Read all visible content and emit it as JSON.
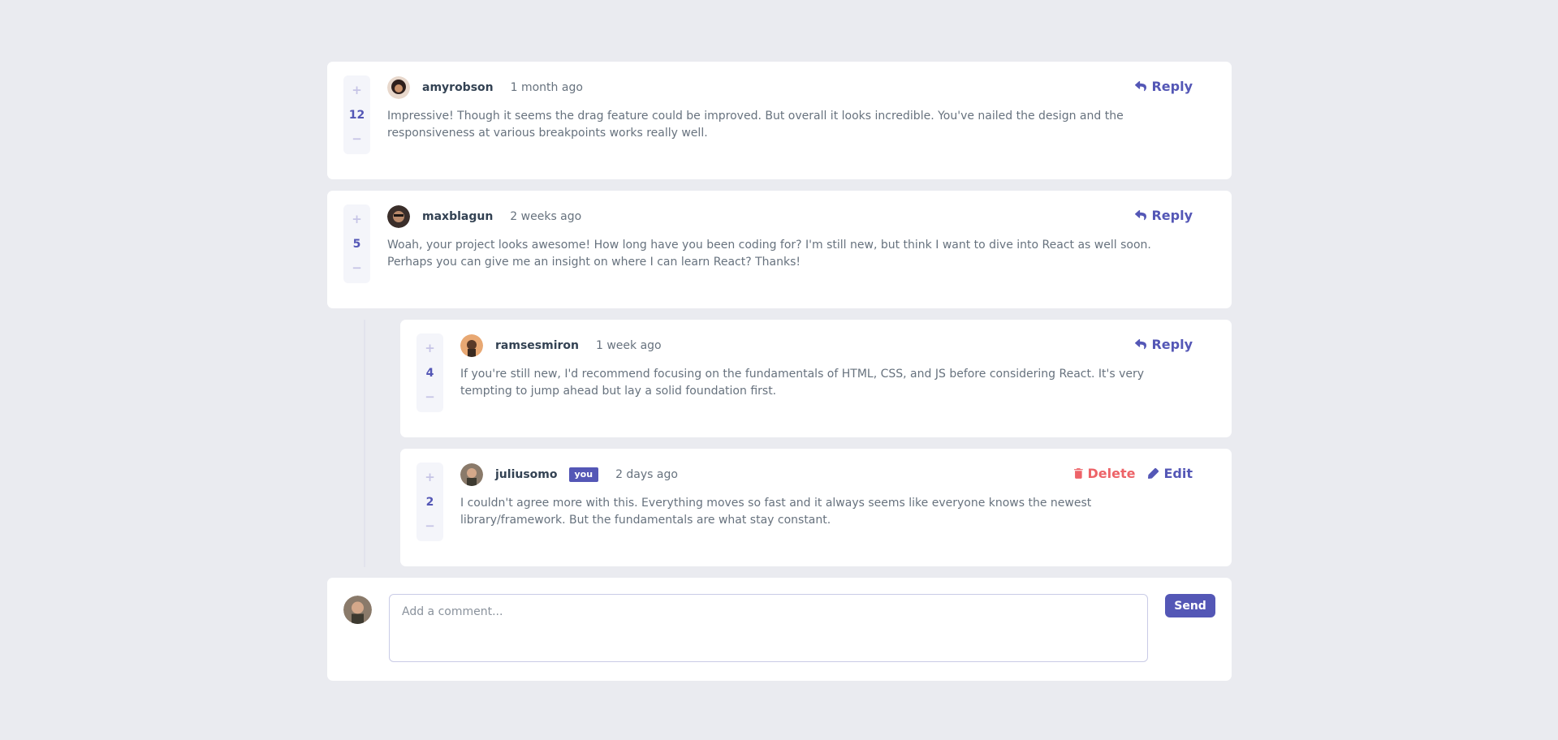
{
  "comments": [
    {
      "score": "12",
      "username": "amyrobson",
      "time": "1 month ago",
      "text": "Impressive! Though it seems the drag feature could be improved. But overall it looks incredible. You've nailed the design and the responsiveness at various breakpoints works really well.",
      "reply_label": "Reply",
      "avatar_color": "#3a2a2a"
    },
    {
      "score": "5",
      "username": "maxblagun",
      "time": "2 weeks ago",
      "text": "Woah, your project looks awesome! How long have you been coding for? I'm still new, but think I want to dive into React as well soon. Perhaps you can give me an insight on where I can learn React? Thanks!",
      "reply_label": "Reply",
      "avatar_color": "#2c2320",
      "replies": [
        {
          "score": "4",
          "username": "ramsesmiron",
          "time": "1 week ago",
          "text": "If you're still new, I'd recommend focusing on the fundamentals of HTML, CSS, and JS before considering React. It's very tempting to jump ahead but lay a solid foundation first.",
          "reply_label": "Reply",
          "avatar_color": "#e0a36a"
        },
        {
          "score": "2",
          "username": "juliusomo",
          "you_badge": "you",
          "time": "2 days ago",
          "text": "I couldn't agree more with this. Everything moves so fast and it always seems like everyone knows the newest library/framework. But the fundamentals are what stay constant.",
          "delete_label": "Delete",
          "edit_label": "Edit",
          "avatar_color": "#6b5a4a"
        }
      ]
    }
  ],
  "vote": {
    "plus": "+",
    "minus": "−"
  },
  "compose": {
    "placeholder": "Add a comment...",
    "send_label": "Send"
  },
  "colors": {
    "accent": "#5457b6",
    "danger": "#ed6368",
    "background": "#eaebf0"
  }
}
